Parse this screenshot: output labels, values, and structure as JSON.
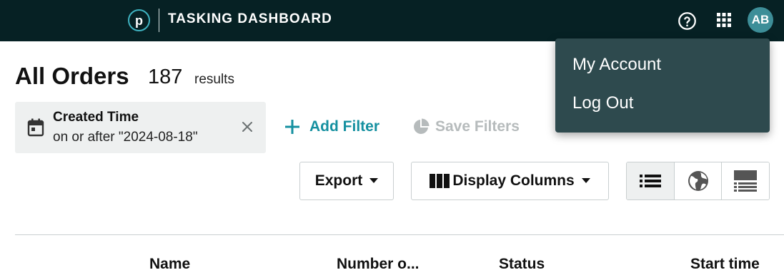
{
  "header": {
    "logo_letter": "p",
    "app_title": "TASKING DASHBOARD",
    "avatar_initials": "AB",
    "icons": [
      "help-icon",
      "apps-grid-icon"
    ],
    "background_color": "#062124",
    "avatar_color": "#3d8e98"
  },
  "account_menu": {
    "items": [
      {
        "label": "My Account"
      },
      {
        "label": "Log Out"
      }
    ],
    "background_color": "#2e4a4e"
  },
  "page": {
    "title": "All Orders",
    "result_count": "187",
    "result_label": "results"
  },
  "filters": {
    "active": [
      {
        "title": "Created Time",
        "value": "on or after \"2024-08-18\"",
        "icon": "calendar-icon"
      }
    ],
    "add_label": "Add Filter",
    "save_label": "Save Filters",
    "accent_color": "#1590a0"
  },
  "toolbar": {
    "export_label": "Export",
    "columns_label": "Display Columns",
    "views": [
      {
        "name": "list-view",
        "icon": "list-icon",
        "active": true
      },
      {
        "name": "map-view",
        "icon": "globe-icon",
        "active": false
      },
      {
        "name": "detail-view",
        "icon": "detail-list-icon",
        "active": false
      }
    ]
  },
  "table": {
    "columns": [
      "Name",
      "Number o...",
      "Status",
      "Start time"
    ]
  }
}
